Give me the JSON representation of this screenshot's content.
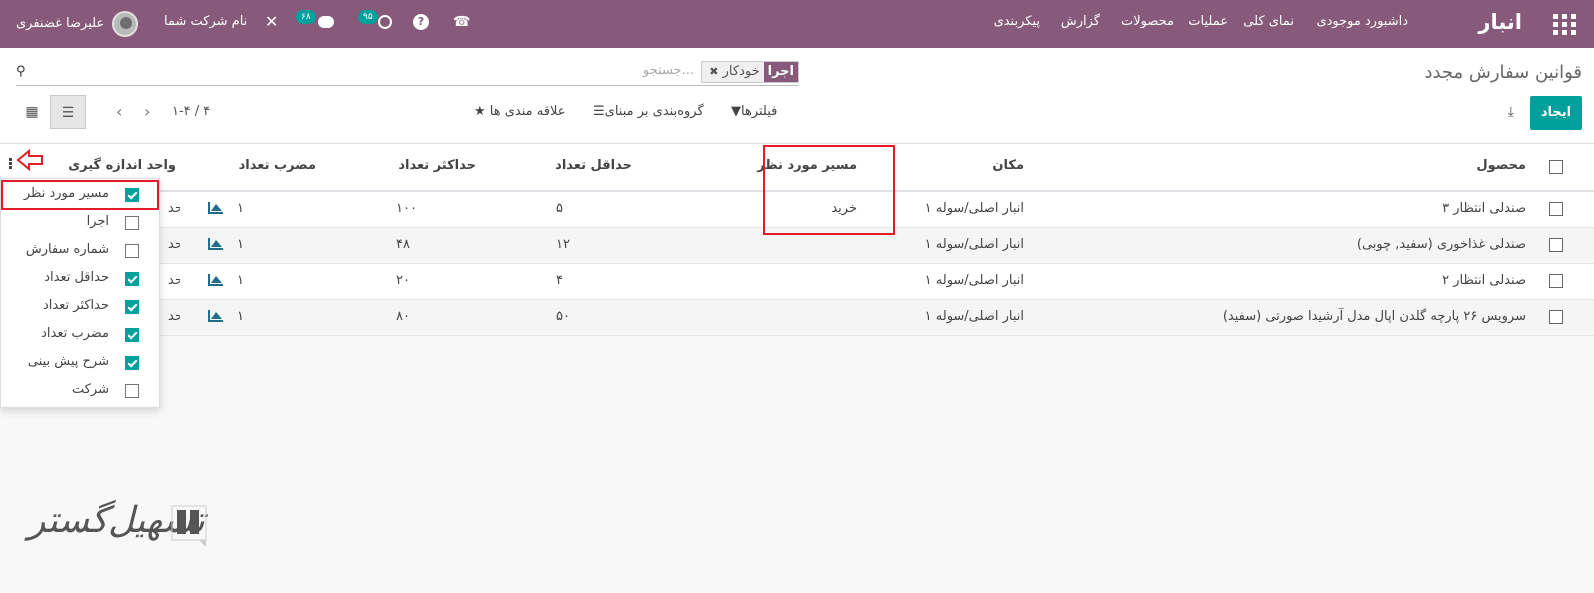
{
  "navbar": {
    "brand": "انبار",
    "menu": [
      "داشبورد موجودی",
      "نمای کلی",
      "عملیات",
      "محصولات",
      "گزارش",
      "پیکربندی"
    ],
    "messages_count": "۶۸",
    "activities_count": "۹۵",
    "company": "نام شرکت شما",
    "user": "علیرضا غضنفری",
    "bg_color": "#875a7b"
  },
  "control_panel": {
    "title": "قوانین سفارش مجدد",
    "search_placeholder": "جستجو...",
    "facet_label": "اجرا",
    "facet_value": "خودکار",
    "create_label": "ایجاد",
    "filters_label": "فیلترها",
    "groupby_label": "گروه‌بندی بر مبنای",
    "favorites_label": "علاقه مندی ها",
    "pager": "۱-۴ / ۴",
    "accent_color": "#00a09d"
  },
  "table": {
    "columns": {
      "product": "محصول",
      "location": "مکان",
      "route": "مسیر مورد نظر",
      "min_qty": "حداقل تعداد",
      "max_qty": "حداکثر تعداد",
      "multiple": "مضرب تعداد",
      "uom": "واحد اندازه گیری"
    },
    "rows": [
      {
        "product": "صندلی انتظار ۳",
        "location": "انبار اصلی/سوله ۱",
        "route": "خرید",
        "min": "۵",
        "max": "۱۰۰",
        "multiple": "۱",
        "uom": "واحد"
      },
      {
        "product": "صندلی غذاخوری (سفید, چوبی)",
        "location": "انبار اصلی/سوله ۱",
        "route": "",
        "min": "۱۲",
        "max": "۴۸",
        "multiple": "۱",
        "uom": "واحد"
      },
      {
        "product": "صندلی انتظار ۲",
        "location": "انبار اصلی/سوله ۱",
        "route": "",
        "min": "۴",
        "max": "۲۰",
        "multiple": "۱",
        "uom": "واحد"
      },
      {
        "product": "سرویس ۲۶ پارچه گلدن اپال مدل آرشیدا صورتی (سفید)",
        "location": "انبار اصلی/سوله ۱",
        "route": "",
        "min": "۵۰",
        "max": "۸۰",
        "multiple": "۱",
        "uom": "واحد"
      }
    ]
  },
  "optional_columns": [
    {
      "label": "مسیر مورد نظر",
      "checked": true
    },
    {
      "label": "اجرا",
      "checked": false
    },
    {
      "label": "شماره سفارش",
      "checked": false
    },
    {
      "label": "حداقل تعداد",
      "checked": true
    },
    {
      "label": "حداکثر تعداد",
      "checked": true
    },
    {
      "label": "مضرب تعداد",
      "checked": true
    },
    {
      "label": "شرح پیش بینی",
      "checked": true
    },
    {
      "label": "شرکت",
      "checked": false
    }
  ],
  "watermark": "تسهیل‌گستر",
  "highlight_color": "#e21c2c"
}
